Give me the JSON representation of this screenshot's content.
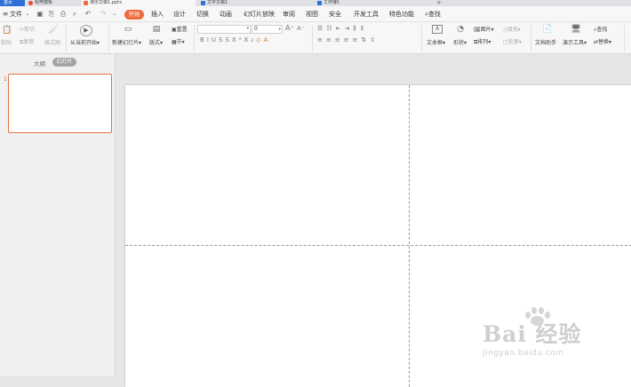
{
  "tabs": [
    {
      "label": "首页",
      "kind": "home"
    },
    {
      "label": "稻壳模板",
      "kind": "docer",
      "color": "#e04b3a"
    },
    {
      "label": "演示文稿1.pptx",
      "kind": "active",
      "color": "#ee6a3b"
    },
    {
      "label": "文字文稿1",
      "kind": "doc",
      "color": "#2f6fd6"
    },
    {
      "label": "工作簿1",
      "kind": "sheet",
      "color": "#2f6fd6"
    }
  ],
  "tab_add": "+",
  "menu": {
    "file": "文件",
    "start": "开始",
    "items": [
      "插入",
      "设计",
      "切换",
      "动画",
      "幻灯片放映",
      "审阅",
      "视图",
      "安全",
      "开发工具",
      "特色功能"
    ],
    "search": "查找"
  },
  "ribbon": {
    "paste": "粘贴",
    "cut": "剪切",
    "copy": "复制",
    "format_painter": "格式刷",
    "from_current": "从当前开始",
    "new_slide": "新建幻灯片",
    "layout": "版式",
    "reset": "重置",
    "section": "节",
    "font_size": "0",
    "text_box": "文本框",
    "shape": "形状",
    "picture": "图片",
    "arrange": "排列",
    "fill": "填充",
    "outline": "轮廓",
    "doc_helper": "文档助手",
    "present_tool": "演示工具",
    "find": "查找",
    "replace": "替换"
  },
  "sidepanel": {
    "outline_tab": "大纲",
    "slides_tab": "幻灯片",
    "slide_number": "1"
  },
  "watermark": {
    "brand": "Bai 经验",
    "url": "jingyan.baidu.com"
  },
  "colors": {
    "accent": "#ee6a3b",
    "home_tab": "#2f6fd6",
    "thumb_border": "#e0743f"
  }
}
